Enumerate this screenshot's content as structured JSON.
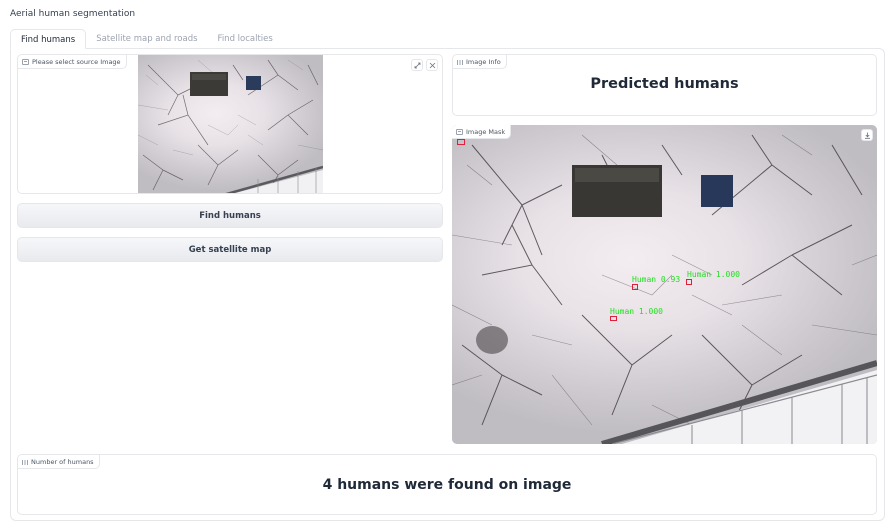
{
  "app": {
    "title": "Aerial human segmentation"
  },
  "tabs": [
    {
      "label": "Find humans",
      "active": true
    },
    {
      "label": "Satellite map and roads",
      "active": false
    },
    {
      "label": "Find localties",
      "active": false
    }
  ],
  "source_image": {
    "label": "Please select source Image",
    "icon": "image-icon",
    "actions": [
      {
        "icon": "edit-icon"
      },
      {
        "icon": "close-icon"
      }
    ]
  },
  "buttons": {
    "find_humans": "Find humans",
    "get_satellite_map": "Get satellite map"
  },
  "image_info": {
    "label": "Image Info",
    "text": "Predicted humans"
  },
  "image_mask": {
    "label": "Image Mask",
    "download_icon": "download-icon",
    "detections": [
      {
        "label": "Human 0.93"
      },
      {
        "label": "Human 1.000"
      },
      {
        "label": "Human 1.000"
      }
    ]
  },
  "number_of_humans": {
    "label": "Number of humans",
    "text": "4 humans were found on image"
  },
  "colors": {
    "detection_text": "#22e022",
    "detection_box": "#e0203a",
    "button_bg": "#eceef1",
    "border": "#e5e7eb"
  }
}
